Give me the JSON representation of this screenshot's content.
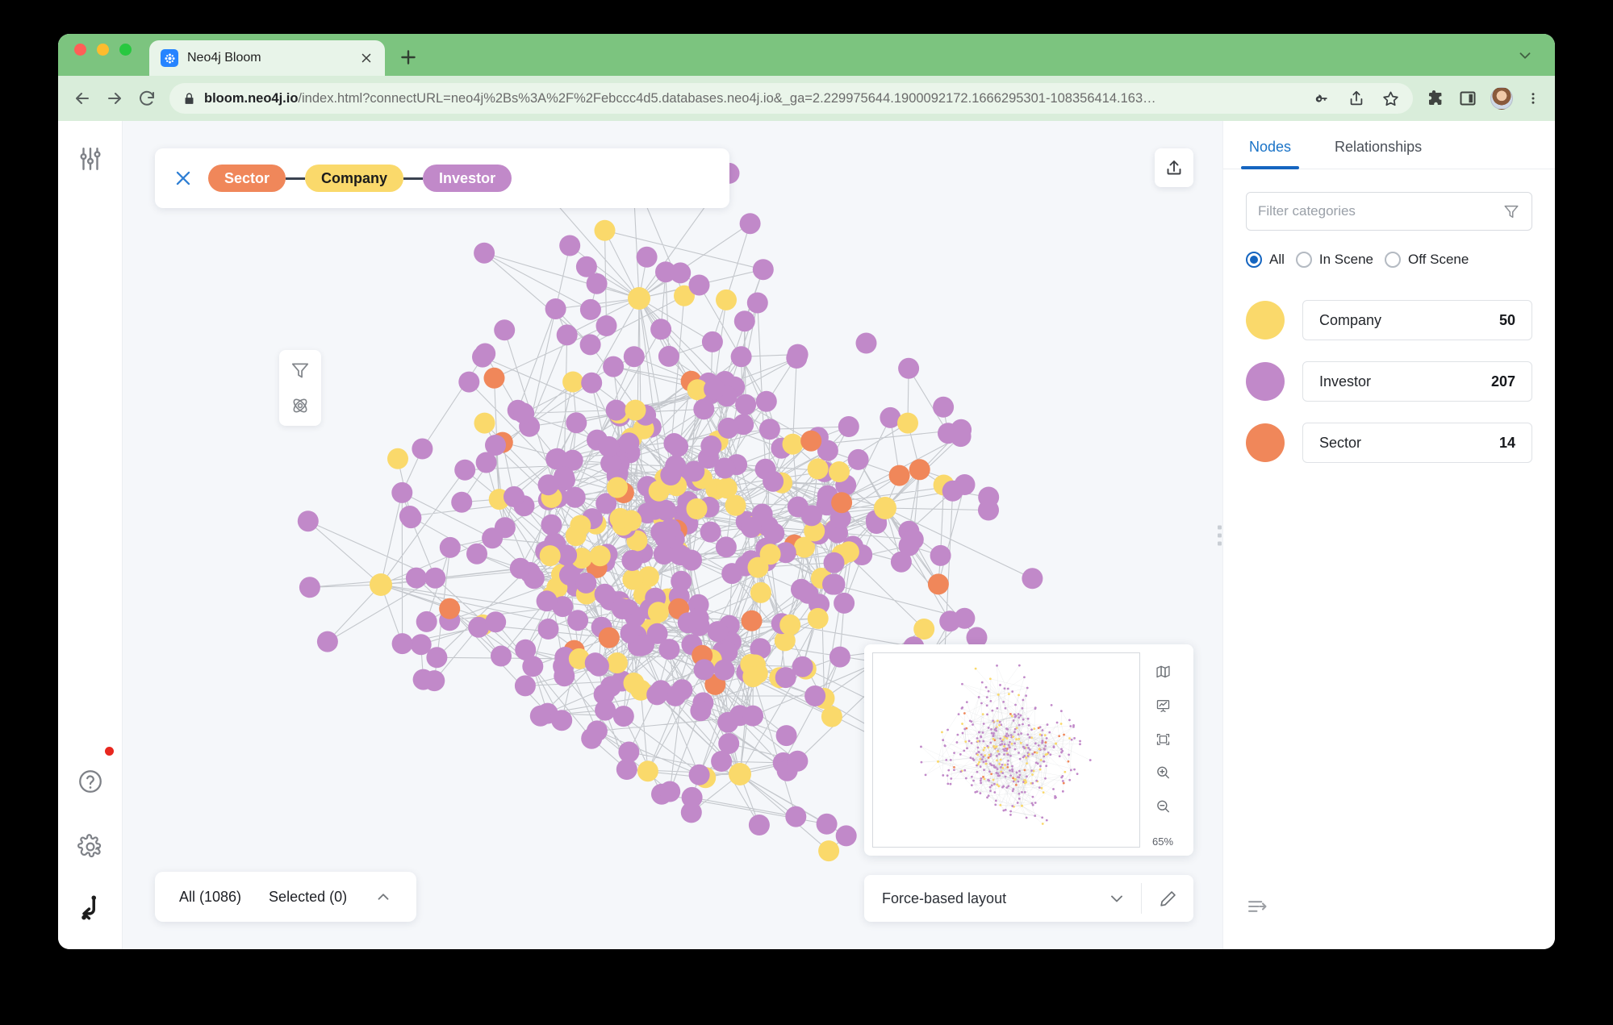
{
  "browser": {
    "tab": {
      "title": "Neo4j Bloom",
      "favicon": "neo4j-favicon",
      "close": "×"
    },
    "new_tab_label": "+",
    "url_bold": "bloom.neo4j.io",
    "url_rest": "/index.html?connectURL=neo4j%2Bs%3A%2F%2Febccc4d5.databases.neo4j.io&_ga=2.229975644.1900092172.1666295301-108356414.163…",
    "nav_icons": [
      "back-icon",
      "forward-icon",
      "reload-icon"
    ],
    "omnibox_icons": [
      "lock-icon",
      "password-key-icon",
      "share-icon",
      "bookmark-star-icon"
    ],
    "toolbar_icons": [
      "extensions-puzzle-icon",
      "side-panel-icon",
      "profile-avatar",
      "chrome-menu-icon"
    ],
    "window_chevron": "chevron-down-icon"
  },
  "left_rail": {
    "top_icon": "sliders-icon",
    "bottom_icons": [
      "help-circle-icon",
      "settings-gear-icon",
      "neo4j-logo-icon"
    ],
    "notification_dot_color": "#e8271f"
  },
  "search_bar": {
    "close_label": "×",
    "pills": [
      {
        "label": "Sector",
        "bg": "#f0875a",
        "fg": "#ffffff"
      },
      {
        "label": "Company",
        "bg": "#fad96b",
        "fg": "#1c1c1c"
      },
      {
        "label": "Investor",
        "bg": "#c189c9",
        "fg": "#ffffff"
      }
    ]
  },
  "canvas_tools": [
    "filter-funnel-icon",
    "cluster-atom-icon"
  ],
  "export_button": {
    "icon": "upload-export-icon"
  },
  "status_bar": {
    "all_label": "All (1086)",
    "selected_label": "Selected (0)",
    "caret": "chevron-up-icon"
  },
  "minimap": {
    "zoom_level": "65%",
    "tools": [
      "map-icon",
      "slideshow-chart-icon",
      "fit-to-screen-icon",
      "zoom-in-icon",
      "zoom-out-icon"
    ]
  },
  "layout_bar": {
    "selected": "Force-based layout",
    "chevron": "chevron-down-icon",
    "edit_icon": "pencil-edit-icon"
  },
  "right_panel": {
    "tabs": [
      {
        "label": "Nodes",
        "active": true
      },
      {
        "label": "Relationships",
        "active": false
      }
    ],
    "filter": {
      "placeholder": "Filter categories",
      "value": "",
      "icon": "filter-funnel-icon"
    },
    "scope_options": [
      {
        "label": "All",
        "selected": true
      },
      {
        "label": "In Scene",
        "selected": false
      },
      {
        "label": "Off Scene",
        "selected": false
      }
    ],
    "categories": [
      {
        "name": "Company",
        "count": "50",
        "color": "#fad96b"
      },
      {
        "name": "Investor",
        "count": "207",
        "color": "#c189c9"
      },
      {
        "name": "Sector",
        "count": "14",
        "color": "#f0875a"
      }
    ],
    "bottom_icon": "sort-arrow-icon",
    "drag_handle": "panel-drag-handle"
  },
  "graph": {
    "node_colors": {
      "Company": "#fad96b",
      "Investor": "#c189c9",
      "Sector": "#f0875a"
    },
    "edge_color": "#9aa0a6",
    "total_nodes": 1086,
    "canvas_background": "#f5f7fa"
  }
}
